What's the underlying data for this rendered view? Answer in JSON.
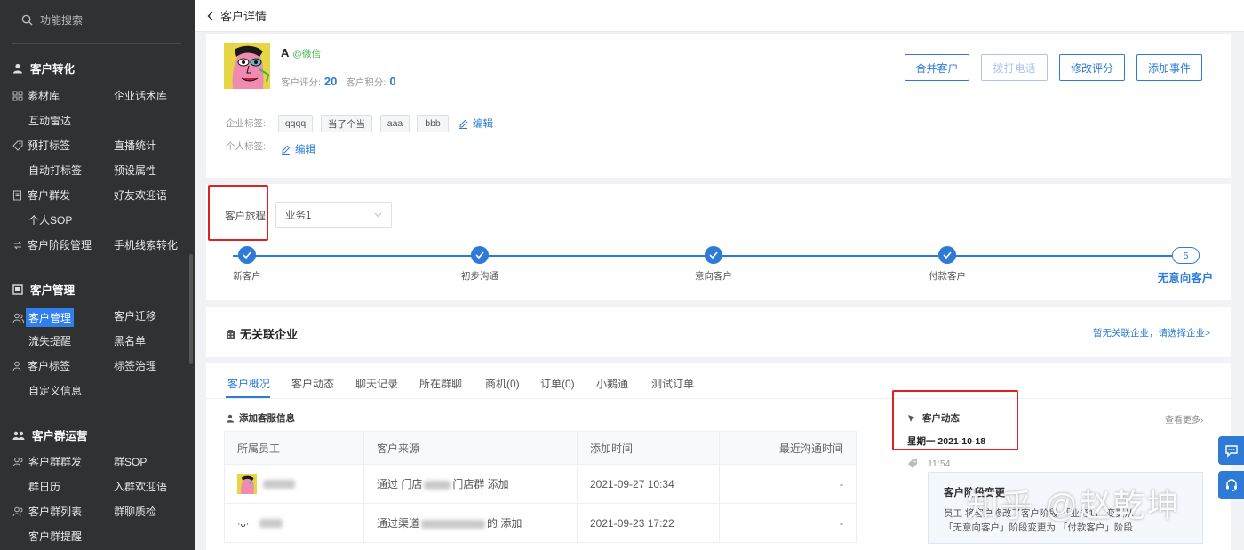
{
  "sidebar": {
    "search_placeholder": "功能搜索",
    "groups": [
      {
        "title": "客户转化",
        "items": [
          "素材库",
          "企业话术库",
          "互动雷达",
          "预打标签",
          "直播统计",
          "自动打标签",
          "预设属性",
          "客户群发",
          "好友欢迎语",
          "个人SOP",
          "客户阶段管理",
          "手机线索转化"
        ]
      },
      {
        "title": "客户管理",
        "items": [
          "客户管理",
          "客户迁移",
          "流失提醒",
          "黑名单",
          "客户标签",
          "标签治理",
          "自定义信息"
        ]
      },
      {
        "title": "客户群运营",
        "items": [
          "客户群群发",
          "群SOP",
          "群日历",
          "入群欢迎语",
          "客户群列表",
          "群聊质检",
          "客户群提醒"
        ]
      }
    ],
    "active_item": "客户管理"
  },
  "header": {
    "back_label": "客户详情"
  },
  "profile": {
    "name": "A",
    "source": "@微信",
    "score_label": "客户评分:",
    "score_value": "20",
    "points_label": "客户积分:",
    "points_value": "0",
    "buttons": [
      "合并客户",
      "拨打电话",
      "修改评分",
      "添加事件"
    ],
    "enterprise_tags_label": "企业标签:",
    "enterprise_tags": [
      "qqqq",
      "当了个当",
      "aaa",
      "bbb"
    ],
    "edit_label": "编辑",
    "personal_tags_label": "个人标签:"
  },
  "journey": {
    "label": "客户旅程",
    "select_value": "业务1",
    "steps": [
      "新客户",
      "初步沟通",
      "意向客户",
      "付款客户",
      "无意向客户"
    ],
    "current_step_number": "5"
  },
  "enterprise": {
    "title": "无关联企业",
    "link": "暂无关联企业，请选择企业>"
  },
  "tabs": [
    "客户概况",
    "客户动态",
    "聊天记录",
    "所在群聊",
    "商机(0)",
    "订单(0)",
    "小鹅通",
    "测试订单"
  ],
  "service_info": {
    "title": "添加客服信息",
    "columns": [
      "所属员工",
      "客户来源",
      "添加时间",
      "最近沟通时间"
    ],
    "rows": [
      {
        "source_prefix": "通过 门店",
        "source_suffix": "门店群 添加",
        "time": "2021-09-27 10:34",
        "last": "-"
      },
      {
        "source_prefix": "通过渠道",
        "source_suffix": "的 添加",
        "time": "2021-09-23 17:22",
        "last": "-"
      }
    ],
    "row2_emoji": "·ᴗ·"
  },
  "activity": {
    "title": "客户动态",
    "more": "查看更多›",
    "date": "星期一 2021-10-18",
    "time": "11:54",
    "event_title": "客户阶段变更",
    "event_line1": "员工 将客户修改了客户阶段 「业务1」 变更从",
    "event_line2": "「无意向客户」阶段变更为 「付款客户」阶段"
  },
  "watermark": "知乎 @赵乾坤",
  "colors": {
    "accent": "#2d7bd6",
    "sidebar_bg": "#2f3133",
    "highlight": "#e02020"
  }
}
